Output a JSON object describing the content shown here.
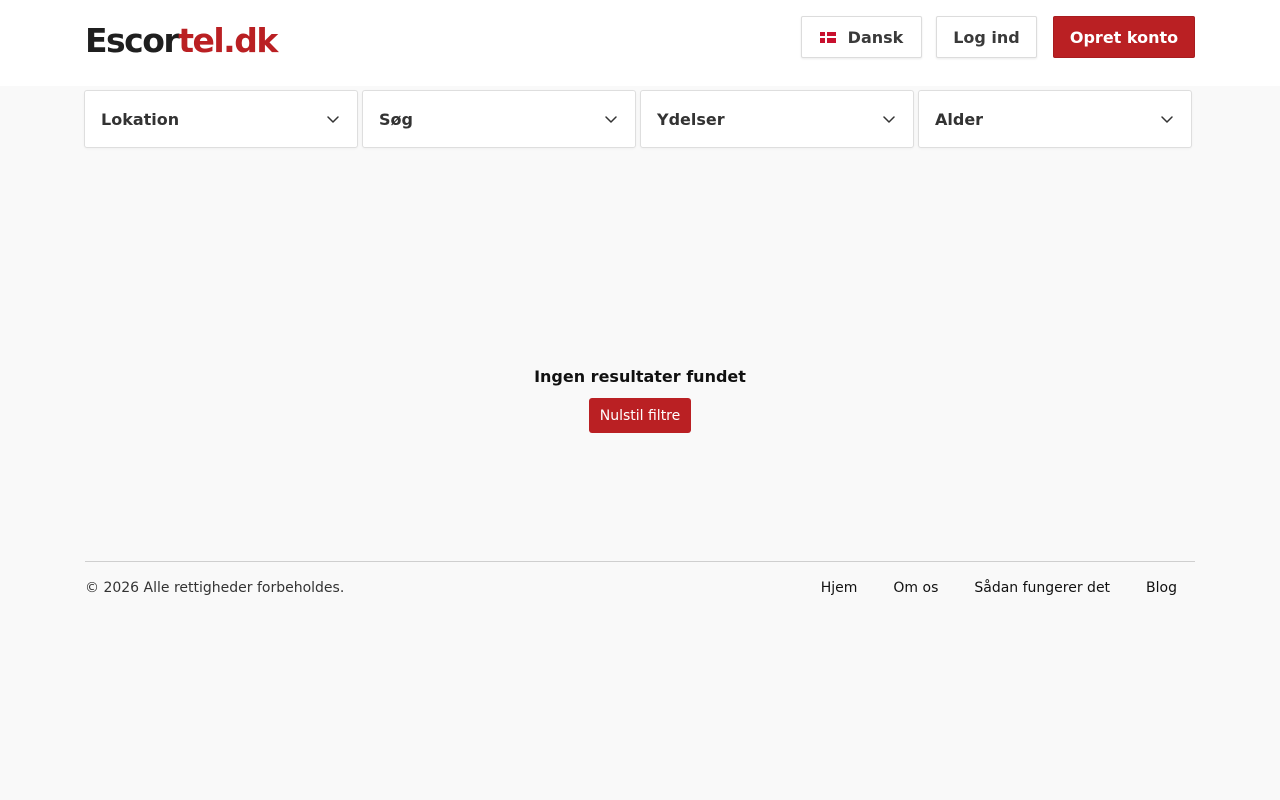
{
  "header": {
    "logo_part1": "Escor",
    "logo_part2": "tel.dk",
    "language_label": "Dansk",
    "language_flag_icon": "denmark-flag-icon",
    "login_label": "Log ind",
    "signup_label": "Opret konto"
  },
  "filters": [
    {
      "label": "Lokation",
      "icon": "chevron-down-icon"
    },
    {
      "label": "Søg",
      "icon": "chevron-down-icon"
    },
    {
      "label": "Ydelser",
      "icon": "chevron-down-icon"
    },
    {
      "label": "Alder",
      "icon": "chevron-down-icon"
    }
  ],
  "results": {
    "empty_message": "Ingen resultater fundet",
    "reset_label": "Nulstil filtre"
  },
  "footer": {
    "copyright": "© 2026 Alle rettigheder forbeholdes.",
    "links": [
      "Hjem",
      "Om os",
      "Sådan fungerer det",
      "Blog"
    ]
  },
  "colors": {
    "brand_red": "#ba2023",
    "text_dark": "#1f1f1f",
    "background": "#f9f9f9"
  }
}
